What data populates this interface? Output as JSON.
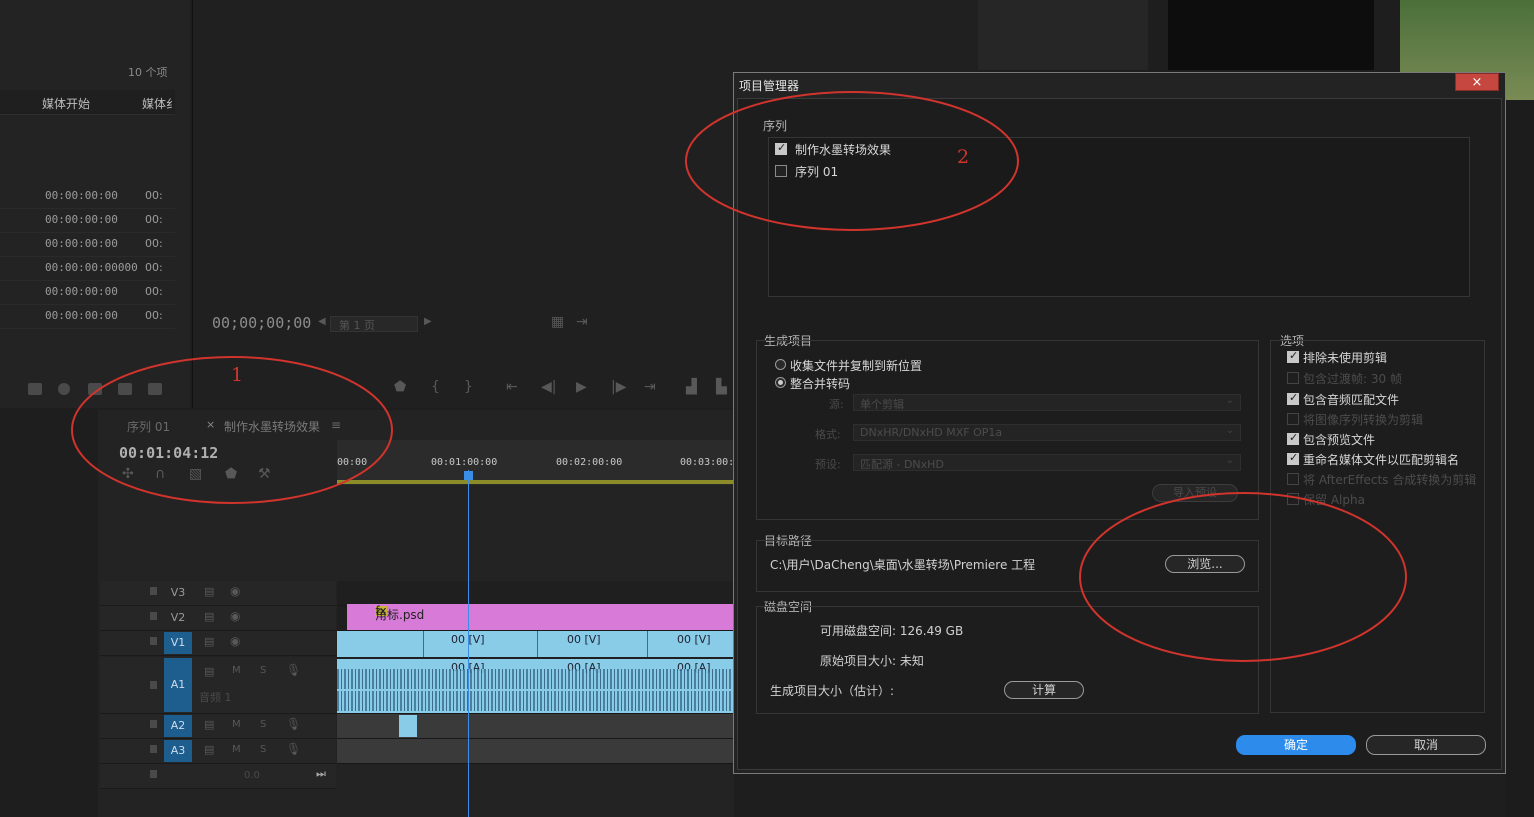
{
  "project_panel": {
    "item_count": "10 个项",
    "col_media_start": "媒体开始",
    "col_media_end": "媒体纟",
    "rows": [
      {
        "tc": "00:00:00:00",
        "tc2": "00:"
      },
      {
        "tc": "00:00:00:00",
        "tc2": "00:"
      },
      {
        "tc": "00:00:00:00",
        "tc2": "00:"
      },
      {
        "tc": "00:00:00:00000",
        "tc2": "00:"
      },
      {
        "tc": "00:00:00:00",
        "tc2": "00:"
      },
      {
        "tc": "00:00:00:00",
        "tc2": "00:"
      }
    ]
  },
  "program_monitor": {
    "timecode": "00;00;00;00",
    "page_select": "第 1 页"
  },
  "timeline": {
    "tab_sequence01": "序列 01",
    "tab_active": "制作水墨转场效果",
    "tab_close": "×",
    "tab_menu": "≡",
    "timecode": "00:01:04:12",
    "ruler": [
      "00:00",
      "00:01:00:00",
      "00:02:00:00",
      "00:03:00:0"
    ],
    "tracks": [
      "V3",
      "V2",
      "V1",
      "A1",
      "A2",
      "A3"
    ],
    "a1_name": "音频 1",
    "master_value": "0.0",
    "v2_clip": "角标.psd",
    "v1_clip_labels": [
      "00 [V]",
      "00 [V]",
      "00 [V]"
    ],
    "a1_clip_labels": [
      "00 [A]",
      "00 [A]",
      "00 [A]"
    ],
    "fx_badge": "fx",
    "track_ms": [
      "M",
      "S"
    ]
  },
  "dialog": {
    "title": "项目管理器",
    "close": "×",
    "sequence_group": "序列",
    "sequences": [
      {
        "label": "制作水墨转场效果",
        "checked": true
      },
      {
        "label": "序列 01",
        "checked": false
      }
    ],
    "result_group": "生成项目",
    "radio_collect": "收集文件并复制到新位置",
    "radio_consolidate": "整合并转码",
    "source_label": "源:",
    "source_value": "单个剪辑",
    "format_label": "格式:",
    "format_value": "DNxHR/DNxHD MXF OP1a",
    "preset_label": "预设:",
    "preset_value": "匹配源 - DNxHD",
    "import_preset": "导入预设",
    "options_group": "选项",
    "options": [
      {
        "label": "排除未使用剪辑",
        "checked": true,
        "enabled": true
      },
      {
        "label": "包含过渡帧:  30 帧",
        "checked": false,
        "enabled": false
      },
      {
        "label": "包含音频匹配文件",
        "checked": true,
        "enabled": true
      },
      {
        "label": "将图像序列转换为剪辑",
        "checked": false,
        "enabled": false
      },
      {
        "label": "包含预览文件",
        "checked": true,
        "enabled": true
      },
      {
        "label": "重命名媒体文件以匹配剪辑名",
        "checked": true,
        "enabled": true
      },
      {
        "label": "将 AfterEffects 合成转换为剪辑",
        "checked": false,
        "enabled": false
      },
      {
        "label": "保留 Alpha",
        "checked": false,
        "enabled": false
      }
    ],
    "dest_group": "目标路径",
    "dest_path": "C:\\用户\\DaCheng\\桌面\\水墨转场\\Premiere 工程",
    "browse": "浏览...",
    "disk_group": "磁盘空间",
    "disk_available": "可用磁盘空间:  126.49 GB",
    "original_size": "原始项目大小:  未知",
    "result_size": "生成项目大小（估计）:",
    "compute": "计算",
    "ok": "确定",
    "cancel": "取消"
  },
  "annotations": [
    "1",
    "2"
  ],
  "colors": {
    "annotation_red": "#d0342c",
    "primary_blue": "#2d8ceb",
    "clip_video": "#88cce8",
    "clip_graphic": "#d87ad8"
  }
}
